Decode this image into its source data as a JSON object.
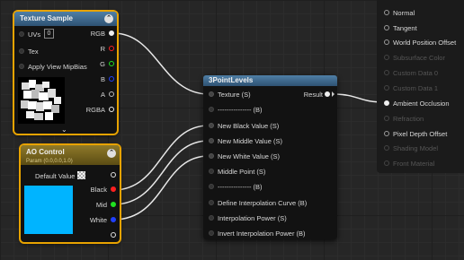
{
  "colors": {
    "accent_selected": "#e8a300",
    "texture_title": "#3f6a90",
    "ao_title": "#7a6620",
    "levels_title": "#3f6a90",
    "pin_red": "#ff2020",
    "pin_green": "#20e020",
    "pin_blue": "#2040ff",
    "ao_swatch": "#00b4ff"
  },
  "texture_sample": {
    "title": "Texture Sample",
    "inputs": [
      {
        "label": "UVs",
        "value": "0"
      },
      {
        "label": "Tex"
      },
      {
        "label": "Apply View MipBias"
      }
    ],
    "outputs": [
      "RGB",
      "R",
      "G",
      "B",
      "A",
      "RGBA"
    ]
  },
  "ao_control": {
    "title": "AO Control",
    "subtitle": "Param (0.0,0.0,1.0)",
    "default_value_label": "Default Value",
    "outputs": [
      "Black",
      "Mid",
      "White"
    ]
  },
  "levels": {
    "title": "3PointLevels",
    "result_label": "Result",
    "inputs": [
      "Texture (S)",
      "--------------- (B)",
      "New Black Value (S)",
      "New Middle Value (S)",
      "New White Value (S)",
      "Middle Point (S)",
      "--------------- (B)",
      "Define Interpolation Curve (B)",
      "Interpolation Power (S)",
      "Invert Interpolation Power (B)"
    ]
  },
  "material": {
    "inputs": [
      {
        "label": "Normal",
        "enabled": true
      },
      {
        "label": "Tangent",
        "enabled": true
      },
      {
        "label": "World Position Offset",
        "enabled": true
      },
      {
        "label": "Subsurface Color",
        "enabled": false
      },
      {
        "label": "Custom Data 0",
        "enabled": false
      },
      {
        "label": "Custom Data 1",
        "enabled": false
      },
      {
        "label": "Ambient Occlusion",
        "enabled": true,
        "connected": true
      },
      {
        "label": "Refraction",
        "enabled": false
      },
      {
        "label": "Pixel Depth Offset",
        "enabled": true
      },
      {
        "label": "Shading Model",
        "enabled": false
      },
      {
        "label": "Front Material",
        "enabled": false
      }
    ]
  }
}
